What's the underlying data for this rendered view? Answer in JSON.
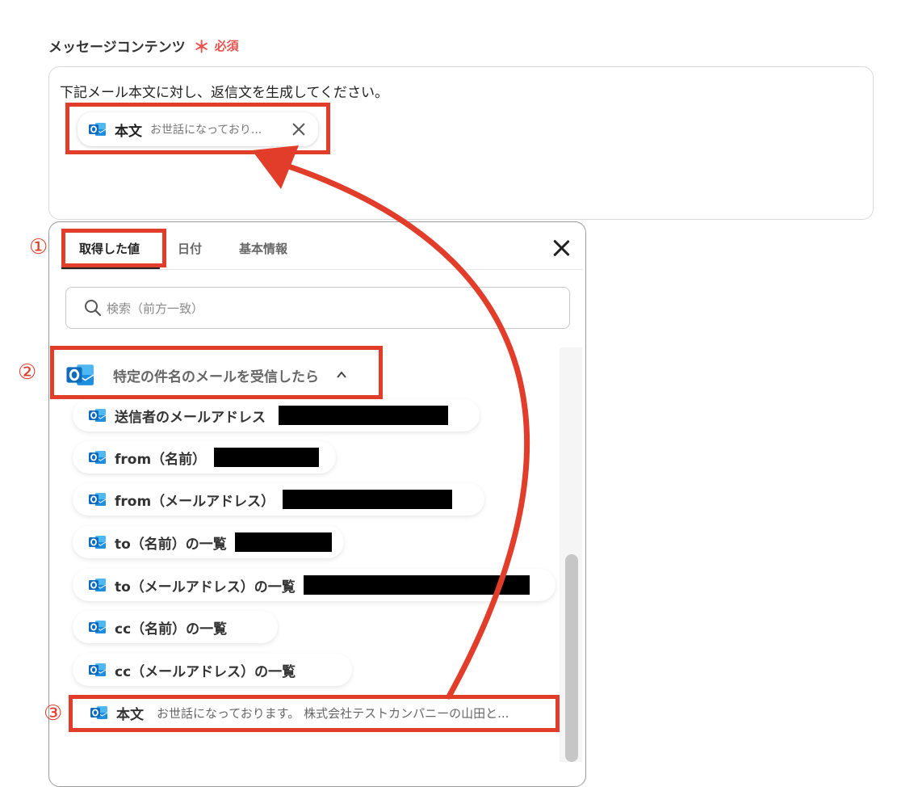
{
  "field": {
    "label": "メッセージコンテンツ",
    "required_mark": "＊",
    "required_text": "必須"
  },
  "editor": {
    "text": "下記メール本文に対し、返信文を生成してください。",
    "chip": {
      "label": "本文",
      "preview": "お世話になっており..."
    }
  },
  "panel": {
    "tabs": [
      "取得した値",
      "日付",
      "基本情報"
    ],
    "active_tab": "取得した値",
    "search_placeholder": "検索（前方一致）",
    "group_title": "特定の件名のメールを受信したら",
    "items": [
      {
        "label": "送信者のメールアドレス",
        "redacted": true
      },
      {
        "label": "from（名前）",
        "redacted": true
      },
      {
        "label": "from（メールアドレス）",
        "redacted": true
      },
      {
        "label": "to（名前）の一覧",
        "redacted": true
      },
      {
        "label": "to（メールアドレス）の一覧",
        "redacted": true
      },
      {
        "label": "cc（名前）の一覧",
        "redacted": false
      },
      {
        "label": "cc（メールアドレス）の一覧",
        "redacted": false
      }
    ],
    "body_item": {
      "label": "本文",
      "preview": "お世話になっております。 株式会社テストカンパニーの山田と..."
    }
  },
  "annotations": {
    "step1": "①",
    "step2": "②",
    "step3": "③",
    "highlight_color": "#e23c2a"
  },
  "icons": {
    "app": "outlook-icon",
    "search": "search-icon",
    "close": "close-icon",
    "collapse": "chevron-up-icon"
  },
  "colors": {
    "required": "#e8534f",
    "annotation": "#e23c2a",
    "outlook_blue": "#0f6cbd",
    "redaction": "#000000"
  }
}
